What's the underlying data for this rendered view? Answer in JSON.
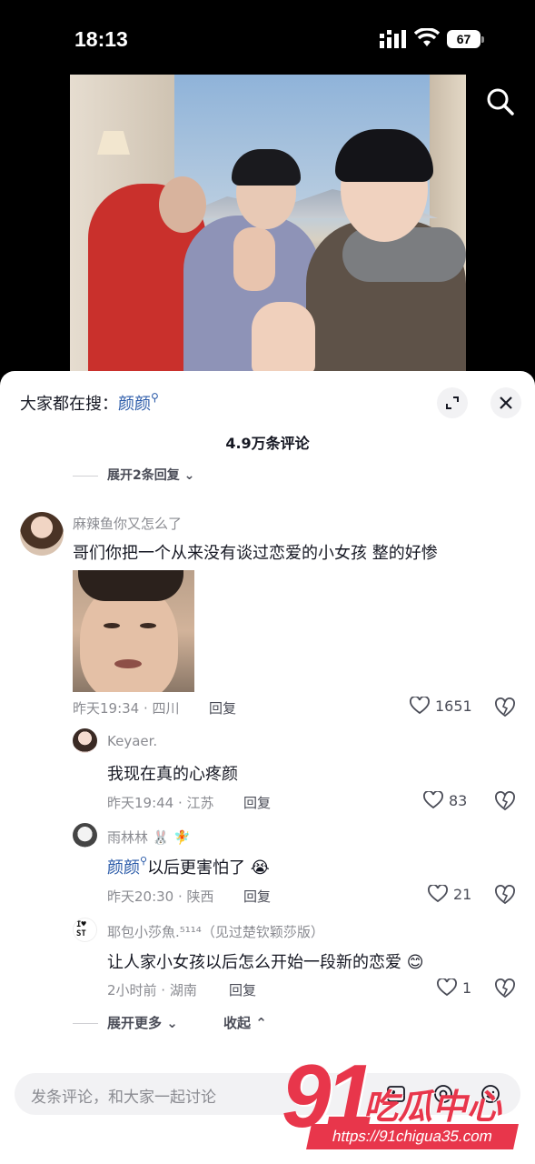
{
  "status_bar": {
    "time": "18:13",
    "battery": "67"
  },
  "search_hint": {
    "prefix": "大家都在搜：",
    "keyword": "颜颜"
  },
  "comments_count": "4.9万条评论",
  "fold_replies": "展开2条回复",
  "comment": {
    "username": "麻辣鱼你又怎么了",
    "text": "哥们你把一个从来没有谈过恋爱的小女孩 整的好惨",
    "meta": "昨天19:34 · 四川",
    "reply_label": "回复",
    "likes": "1651"
  },
  "replies": [
    {
      "username": "Keyaer.",
      "text": "我现在真的心疼颜",
      "meta": "昨天19:44 · 江苏",
      "reply_label": "回复",
      "likes": "83"
    },
    {
      "username": "雨林林 🐰 🧚",
      "keyword": "颜颜",
      "text": "以后更害怕了 😭",
      "meta": "昨天20:30 · 陕西",
      "reply_label": "回复",
      "likes": "21"
    },
    {
      "username": "耶包小莎魚.⁵¹¹⁴（见过楚钦颖莎版）",
      "text": "让人家小女孩以后怎么开始一段新的恋爱 😊",
      "meta": "2小时前 · 湖南",
      "reply_label": "回复",
      "likes": "1",
      "avatar_text": "I♥ ST"
    }
  ],
  "expand_more": "展开更多",
  "collapse": "收起",
  "input_placeholder": "发条评论，和大家一起讨论",
  "watermark": {
    "number": "91",
    "text": "吃瓜中心",
    "url": "https://91chigua35.com"
  },
  "colors": {
    "keyword": "#2a5aa8",
    "watermark": "#e8364b"
  },
  "icons": [
    "search-icon",
    "expand-icon",
    "close-icon",
    "heart-icon",
    "dislike-heart-icon",
    "emoji-icon",
    "at-icon",
    "image-icon"
  ]
}
